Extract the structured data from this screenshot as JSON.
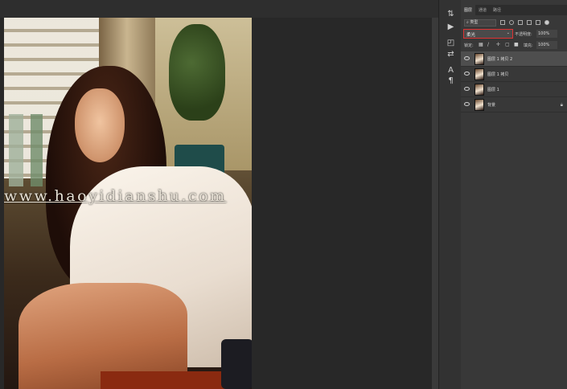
{
  "watermark": "www.haoyidianshu.com",
  "layers_panel": {
    "tabs": [
      {
        "label": "图层",
        "active": true
      },
      {
        "label": "通道",
        "active": false
      },
      {
        "label": "路径",
        "active": false
      }
    ],
    "filter_kind": "类型",
    "blend_mode": "柔光",
    "opacity_label": "不透明度:",
    "opacity_value": "100%",
    "lock_label": "锁定:",
    "fill_label": "填充:",
    "fill_value": "100%",
    "layers": [
      {
        "name": "图层 1 拷贝 2",
        "visible": true,
        "selected": true,
        "locked": false
      },
      {
        "name": "图层 1 拷贝",
        "visible": true,
        "selected": false,
        "locked": false
      },
      {
        "name": "图层 1",
        "visible": true,
        "selected": false,
        "locked": false
      },
      {
        "name": "背景",
        "visible": true,
        "selected": false,
        "locked": true
      }
    ]
  },
  "colors": {
    "highlight_border": "#dd3333",
    "panel_bg": "#383838",
    "canvas_bg": "#282828"
  }
}
